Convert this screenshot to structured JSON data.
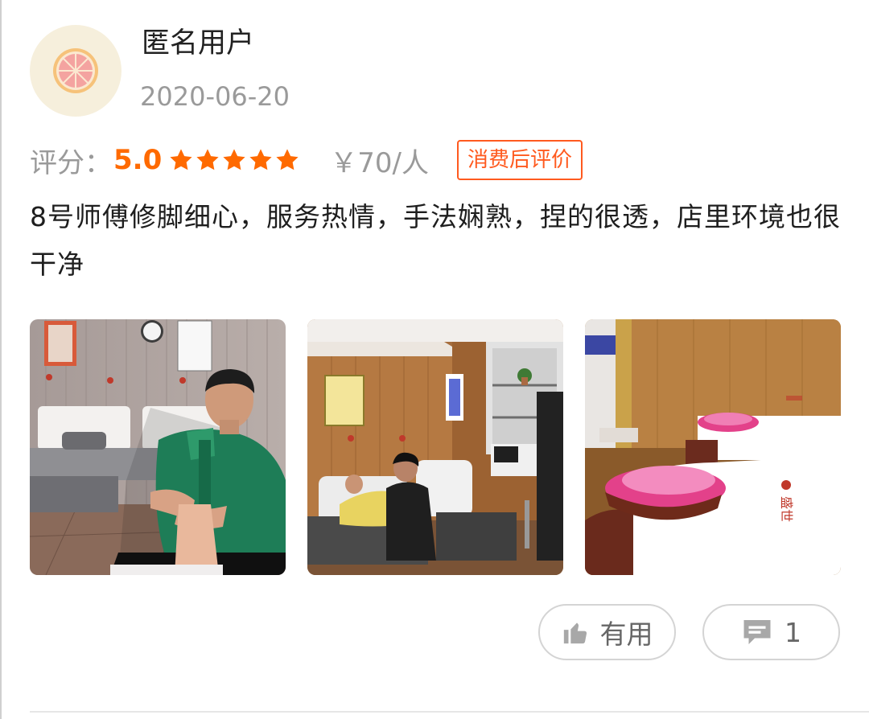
{
  "user": {
    "name": "匿名用户",
    "date": "2020-06-20",
    "avatar_icon": "grapefruit-slice-icon"
  },
  "rating": {
    "label": "评分：",
    "score": "5.0",
    "stars": 5,
    "price": "￥70/人",
    "badge": "消费后评价"
  },
  "review": {
    "text": "8号师傅修脚细心，服务热情，手法娴熟，捏的很透，店里环境也很干净"
  },
  "photos": [
    {
      "subject": "therapist-foot-massage-photo"
    },
    {
      "subject": "massage-room-photo"
    },
    {
      "subject": "massage-beds-photo"
    }
  ],
  "actions": {
    "useful_label": "有用",
    "useful_icon": "thumbs-up-icon",
    "comment_count": "1",
    "comment_icon": "comment-icon"
  },
  "colors": {
    "accent": "#ff6a00",
    "badge": "#ff5a1f",
    "muted": "#9a9a9a"
  }
}
